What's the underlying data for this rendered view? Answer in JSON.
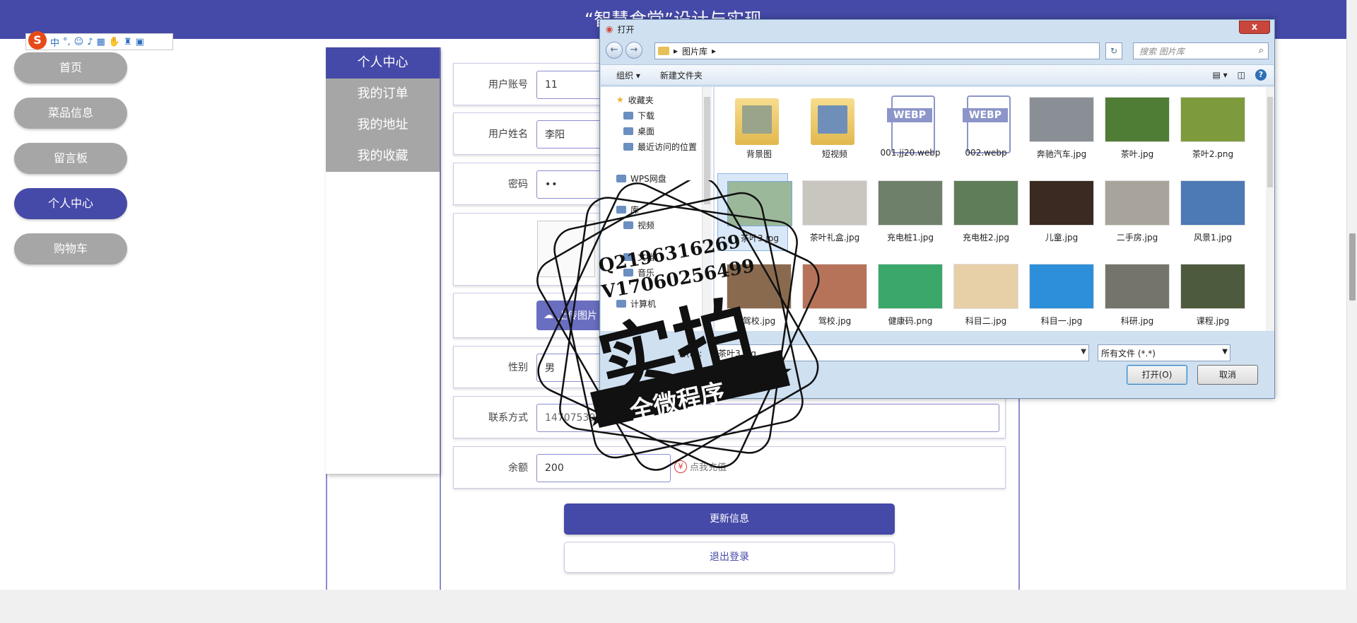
{
  "site": {
    "title": "“智慧食堂”设计与实现"
  },
  "ime": {
    "logo": "S",
    "mode": "中",
    "punct": "°,"
  },
  "leftnav": {
    "items": [
      {
        "label": "首页",
        "active": false
      },
      {
        "label": "菜品信息",
        "active": false
      },
      {
        "label": "留言板",
        "active": false
      },
      {
        "label": "个人中心",
        "active": true
      },
      {
        "label": "购物车",
        "active": false
      }
    ]
  },
  "submenu": {
    "items": [
      {
        "label": "个人中心",
        "active": true
      },
      {
        "label": "我的订单",
        "active": false
      },
      {
        "label": "我的地址",
        "active": false
      },
      {
        "label": "我的收藏",
        "active": false
      }
    ]
  },
  "form": {
    "account": {
      "label": "用户账号",
      "value": "11"
    },
    "name": {
      "label": "用户姓名",
      "value": "李阳"
    },
    "password": {
      "label": "密码",
      "value": "••"
    },
    "upload": {
      "label": "上传图片"
    },
    "gender": {
      "label": "性别",
      "value": "男"
    },
    "phone": {
      "label": "联系方式",
      "value": "14707530000"
    },
    "balance": {
      "label": "余额",
      "value": "200",
      "recharge": "点我充值",
      "recharge_icon": "¥"
    },
    "update_button": "更新信息",
    "logout_button": "退出登录"
  },
  "dialog": {
    "title": "打开",
    "close": "x",
    "breadcrumb": "图片库",
    "search_placeholder": "搜索 图片库",
    "toolbar": {
      "organize": "组织 ▾",
      "new_folder": "新建文件夹",
      "help": "?"
    },
    "tree": {
      "favorites": "收藏夹",
      "downloads": "下载",
      "desktop": "桌面",
      "recent": "最近访问的位置",
      "wps": "WPS网盘",
      "library": "库",
      "video": "视频",
      "docs": "文档",
      "music": "音乐",
      "computer": "计算机"
    },
    "files": [
      {
        "name": "背景图",
        "kind": "folder",
        "color": "#9aa48a"
      },
      {
        "name": "短视频",
        "kind": "folder",
        "color": "#6f8fb8"
      },
      {
        "name": "001.jj20.webp",
        "kind": "webp",
        "tag": "WEBP"
      },
      {
        "name": "002.webp",
        "kind": "webp",
        "tag": "WEBP"
      },
      {
        "name": "奔驰汽车.jpg",
        "kind": "image",
        "color": "#8a8f96"
      },
      {
        "name": "茶叶.jpg",
        "kind": "image",
        "color": "#4f7d35"
      },
      {
        "name": "茶叶2.png",
        "kind": "image",
        "color": "#7d9a3c"
      },
      {
        "name": "茶叶3.jpg",
        "kind": "image",
        "color": "#9bb89a",
        "selected": true
      },
      {
        "name": "茶叶礼盒.jpg",
        "kind": "image",
        "color": "#c9c6c0"
      },
      {
        "name": "充电桩1.jpg",
        "kind": "image",
        "color": "#6e7f6a"
      },
      {
        "name": "充电桩2.jpg",
        "kind": "image",
        "color": "#5f7d58"
      },
      {
        "name": "儿童.jpg",
        "kind": "image",
        "color": "#3a2a22"
      },
      {
        "name": "二手房.jpg",
        "kind": "image",
        "color": "#a9a49b"
      },
      {
        "name": "风景1.jpg",
        "kind": "image",
        "color": "#4d79b5"
      },
      {
        "name": "驾校.jpg",
        "kind": "image",
        "color": "#8a6a4e"
      },
      {
        "name": "驾校.jpg",
        "kind": "image",
        "color": "#b7735a"
      },
      {
        "name": "健康码.png",
        "kind": "image",
        "color": "#3aa86a"
      },
      {
        "name": "科目二.jpg",
        "kind": "image",
        "color": "#e7cfa8"
      },
      {
        "name": "科目一.jpg",
        "kind": "image",
        "color": "#2d8fd9"
      },
      {
        "name": "科研.jpg",
        "kind": "image",
        "color": "#75746b"
      },
      {
        "name": "课程.jpg",
        "kind": "image",
        "color": "#4e5a3d"
      }
    ],
    "filename_value": "茶叶3.jpg",
    "filename_label": "名(N):",
    "filetype": "所有文件 (*.*)",
    "open_button": "打开(O)",
    "cancel_button": "取消"
  },
  "stamp": {
    "line1": "Q2196316269",
    "line2": "V17060256499",
    "big": "实拍",
    "ribbon": "全微程序"
  }
}
